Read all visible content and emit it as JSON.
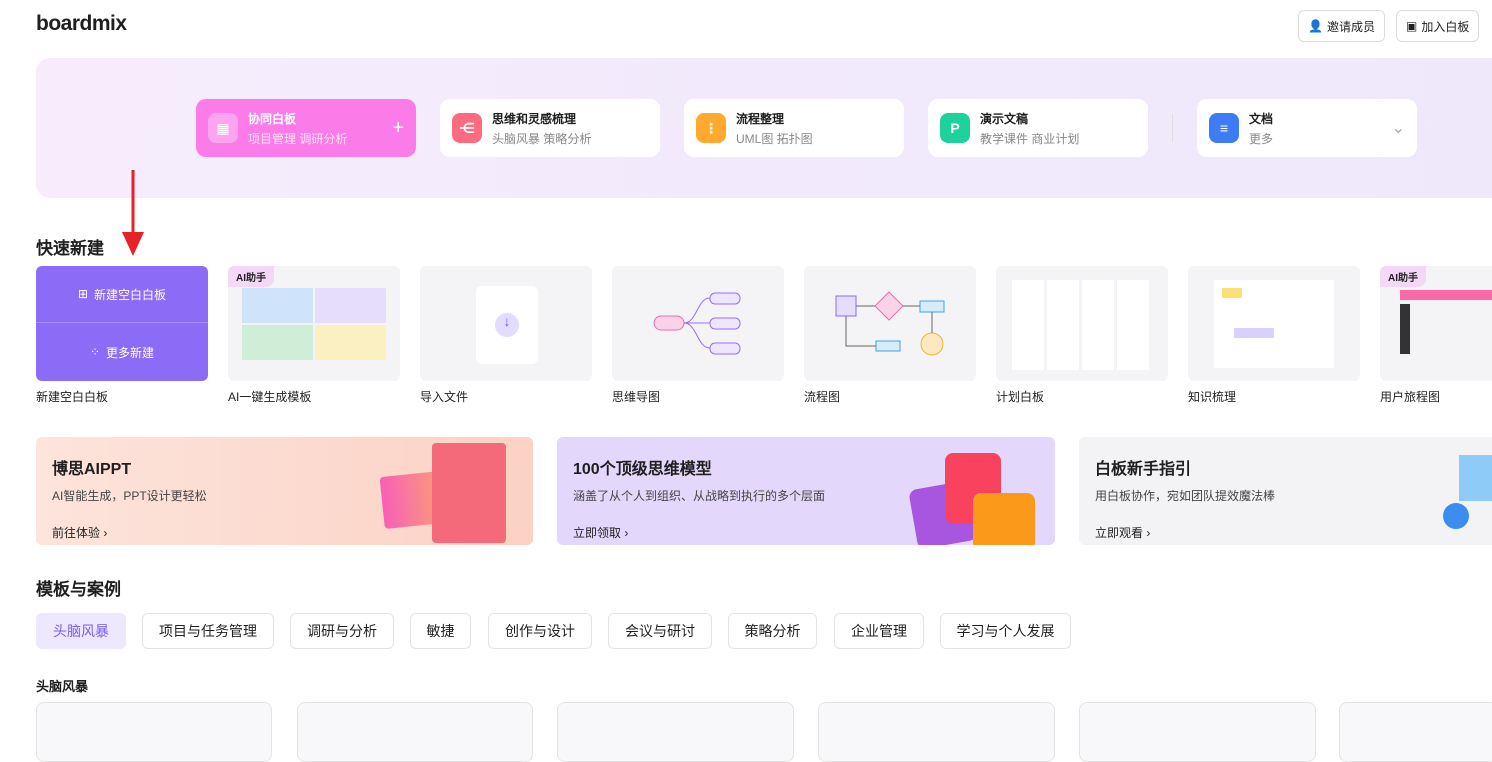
{
  "header": {
    "logo": "boardmix",
    "invite": "邀请成员",
    "join": "加入白板"
  },
  "types": [
    {
      "title": "协同白板",
      "sub": "项目管理 调研分析",
      "color": "#fb7ce8"
    },
    {
      "title": "思维和灵感梳理",
      "sub": "头脑风暴 策略分析",
      "color": "#fd6c7e"
    },
    {
      "title": "流程整理",
      "sub": "UML图 拓扑图",
      "color": "#ffa931"
    },
    {
      "title": "演示文稿",
      "sub": "教学课件 商业计划",
      "color": "#1ed39b"
    },
    {
      "title": "文档",
      "sub": "更多",
      "color": "#3e7cf6"
    }
  ],
  "quick": {
    "title": "快速新建",
    "new_blank": "新建空白白板",
    "more_new": "更多新建",
    "ai_badge": "AI助手",
    "items": [
      "新建空白白板",
      "AI一键生成模板",
      "导入文件",
      "思维导图",
      "流程图",
      "计划白板",
      "知识梳理",
      "用户旅程图"
    ]
  },
  "banners": [
    {
      "title": "博思AIPPT",
      "sub": "AI智能生成，PPT设计更轻松",
      "link": "前往体验"
    },
    {
      "title": "100个顶级思维模型",
      "sub": "涵盖了从个人到组织、从战略到执行的多个层面",
      "link": "立即领取"
    },
    {
      "title": "白板新手指引",
      "sub": "用白板协作，宛如团队提效魔法棒",
      "link": "立即观看"
    }
  ],
  "templates": {
    "title": "模板与案例",
    "tabs": [
      "头脑风暴",
      "项目与任务管理",
      "调研与分析",
      "敏捷",
      "创作与设计",
      "会议与研讨",
      "策略分析",
      "企业管理",
      "学习与个人发展"
    ],
    "section": "头脑风暴"
  }
}
